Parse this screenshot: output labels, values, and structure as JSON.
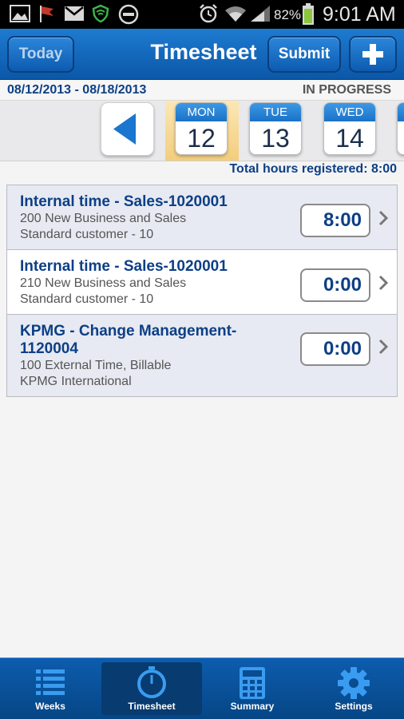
{
  "status_bar": {
    "battery_percent": "82%",
    "time": "9:01 AM"
  },
  "header": {
    "today_label": "Today",
    "title": "Timesheet",
    "submit_label": "Submit",
    "add_label": "+"
  },
  "period": {
    "range": "08/12/2013 - 08/18/2013",
    "status": "IN PROGRESS"
  },
  "days": [
    {
      "name": "MON",
      "number": "12",
      "selected": true
    },
    {
      "name": "TUE",
      "number": "13",
      "selected": false
    },
    {
      "name": "WED",
      "number": "14",
      "selected": false
    }
  ],
  "total_hours_label": "Total hours registered: 8:00",
  "entries": [
    {
      "title": "Internal time - Sales-1020001",
      "line1": "200 New Business and Sales",
      "line2": "Standard customer - 10",
      "hours": "8:00"
    },
    {
      "title": "Internal time - Sales-1020001",
      "line1": "210 New Business and Sales",
      "line2": "Standard customer - 10",
      "hours": "0:00"
    },
    {
      "title": "KPMG - Change Management-1120004",
      "line1": "100 External Time, Billable",
      "line2": "KPMG International",
      "hours": "0:00"
    }
  ],
  "nav": {
    "items": [
      {
        "label": "Weeks",
        "icon": "list-icon",
        "active": false
      },
      {
        "label": "Timesheet",
        "icon": "stopwatch-icon",
        "active": true
      },
      {
        "label": "Summary",
        "icon": "calculator-icon",
        "active": false
      },
      {
        "label": "Settings",
        "icon": "gear-icon",
        "active": false
      }
    ]
  },
  "colors": {
    "brand_blue": "#0b57a8",
    "text_navy": "#0d3f86",
    "selected_day": "#f3cd7c"
  }
}
